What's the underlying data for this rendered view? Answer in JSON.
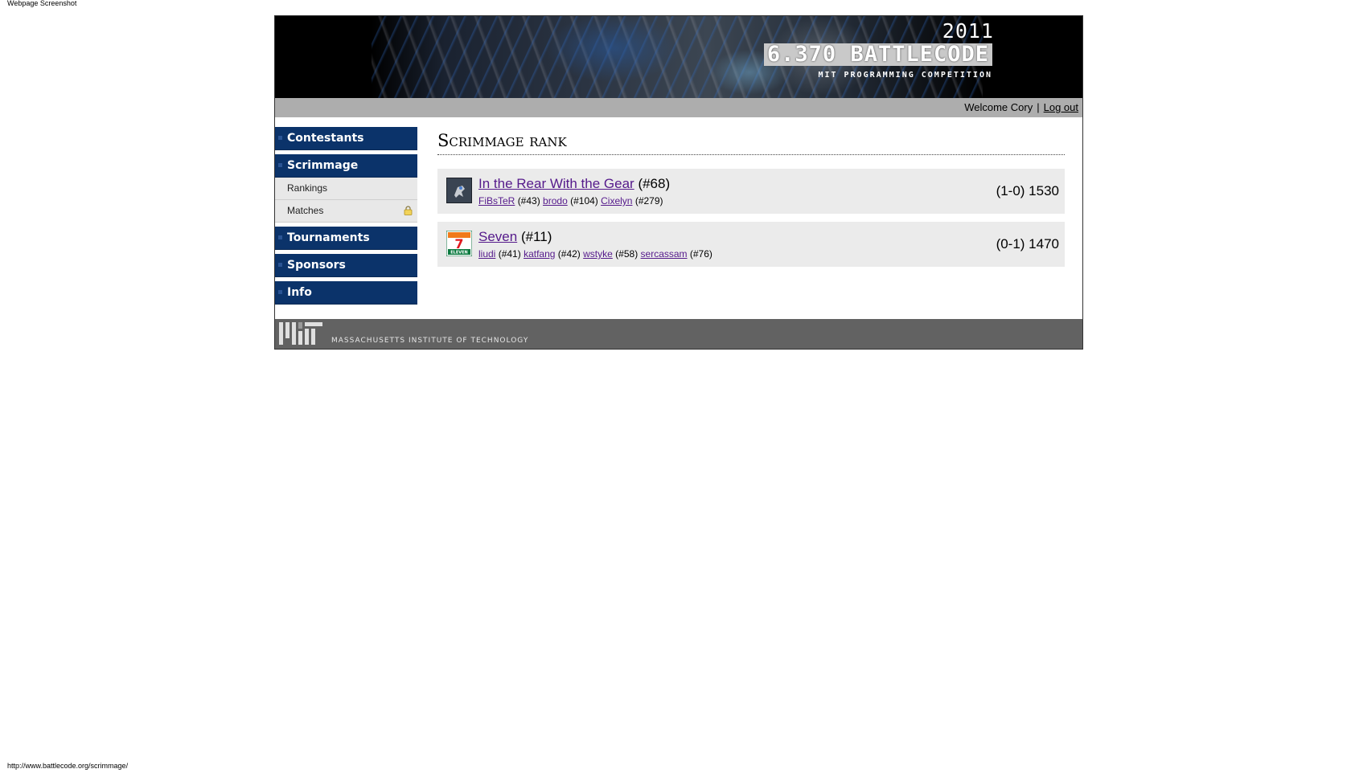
{
  "screenshot": {
    "label": "Webpage Screenshot",
    "url": "http://www.battlecode.org/scrimmage/"
  },
  "banner": {
    "year": "2011",
    "title": "6.370 BATTLECODE",
    "subtitle": "MIT PROGRAMMING COMPETITION"
  },
  "userbar": {
    "welcome": "Welcome Cory",
    "separator": "|",
    "logout": "Log out"
  },
  "sidebar": {
    "sections": [
      {
        "label": "Contestants"
      },
      {
        "label": "Scrimmage",
        "items": [
          {
            "label": "Rankings"
          },
          {
            "label": "Matches",
            "icon": "lock-icon"
          }
        ]
      },
      {
        "label": "Tournaments"
      },
      {
        "label": "Sponsors"
      },
      {
        "label": "Info"
      }
    ]
  },
  "main": {
    "heading": "Scrimmage rank",
    "teams": [
      {
        "name": "In the Rear With the Gear",
        "rank": "(#68)",
        "record": "(1-0) 1530",
        "avatar": "robot-avatar",
        "members": [
          {
            "name": "FiBsTeR",
            "rank": "(#43)"
          },
          {
            "name": "brodo",
            "rank": "(#104)"
          },
          {
            "name": "Cixelyn",
            "rank": "(#279)"
          }
        ]
      },
      {
        "name": "Seven",
        "rank": "(#11)",
        "record": "(0-1) 1470",
        "avatar": "seven-eleven-logo",
        "members": [
          {
            "name": "liudi",
            "rank": "(#41)"
          },
          {
            "name": "katfang",
            "rank": "(#42)"
          },
          {
            "name": "wstyke",
            "rank": "(#58)"
          },
          {
            "name": "sercassam",
            "rank": "(#76)"
          }
        ]
      }
    ]
  },
  "footer": {
    "institution": "MASSACHUSETTS INSTITUTE OF TECHNOLOGY",
    "logo_text": "MIT"
  },
  "colors": {
    "nav_bg": "#0b336a",
    "userbar_bg": "#adadad",
    "footer_bg": "#626262",
    "row_bg": "#ebebeb",
    "link": "#551a8b"
  }
}
